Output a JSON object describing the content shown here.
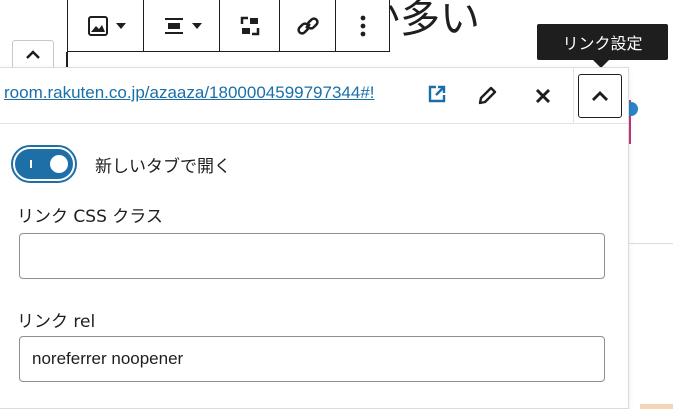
{
  "heading_fragment": "か多い",
  "toolbar": {
    "image_button": "image",
    "align_button": "align",
    "transform_button": "transform",
    "link_button": "link",
    "more_button": "more"
  },
  "tooltip": {
    "text": "リンク設定"
  },
  "link_popover": {
    "url": "room.rakuten.co.jp/azaaza/1800004599797344#!",
    "open_new_tab_label": "新しいタブで開く",
    "open_new_tab_on": true,
    "css_class_label": "リンク CSS クラス",
    "css_class_value": "",
    "rel_label": "リンク rel",
    "rel_value": "noreferrer noopener"
  },
  "colors": {
    "accent": "#1e6fa8",
    "link": "#1a6fa8",
    "tooltip_bg": "#1e1e1e",
    "border": "#8c8f94"
  },
  "icons": [
    "image-icon",
    "chevron-down-icon",
    "align-icon",
    "transform-icon",
    "link-icon",
    "more-vertical-icon",
    "external-link-icon",
    "pencil-icon",
    "close-icon",
    "chevron-up-icon"
  ]
}
